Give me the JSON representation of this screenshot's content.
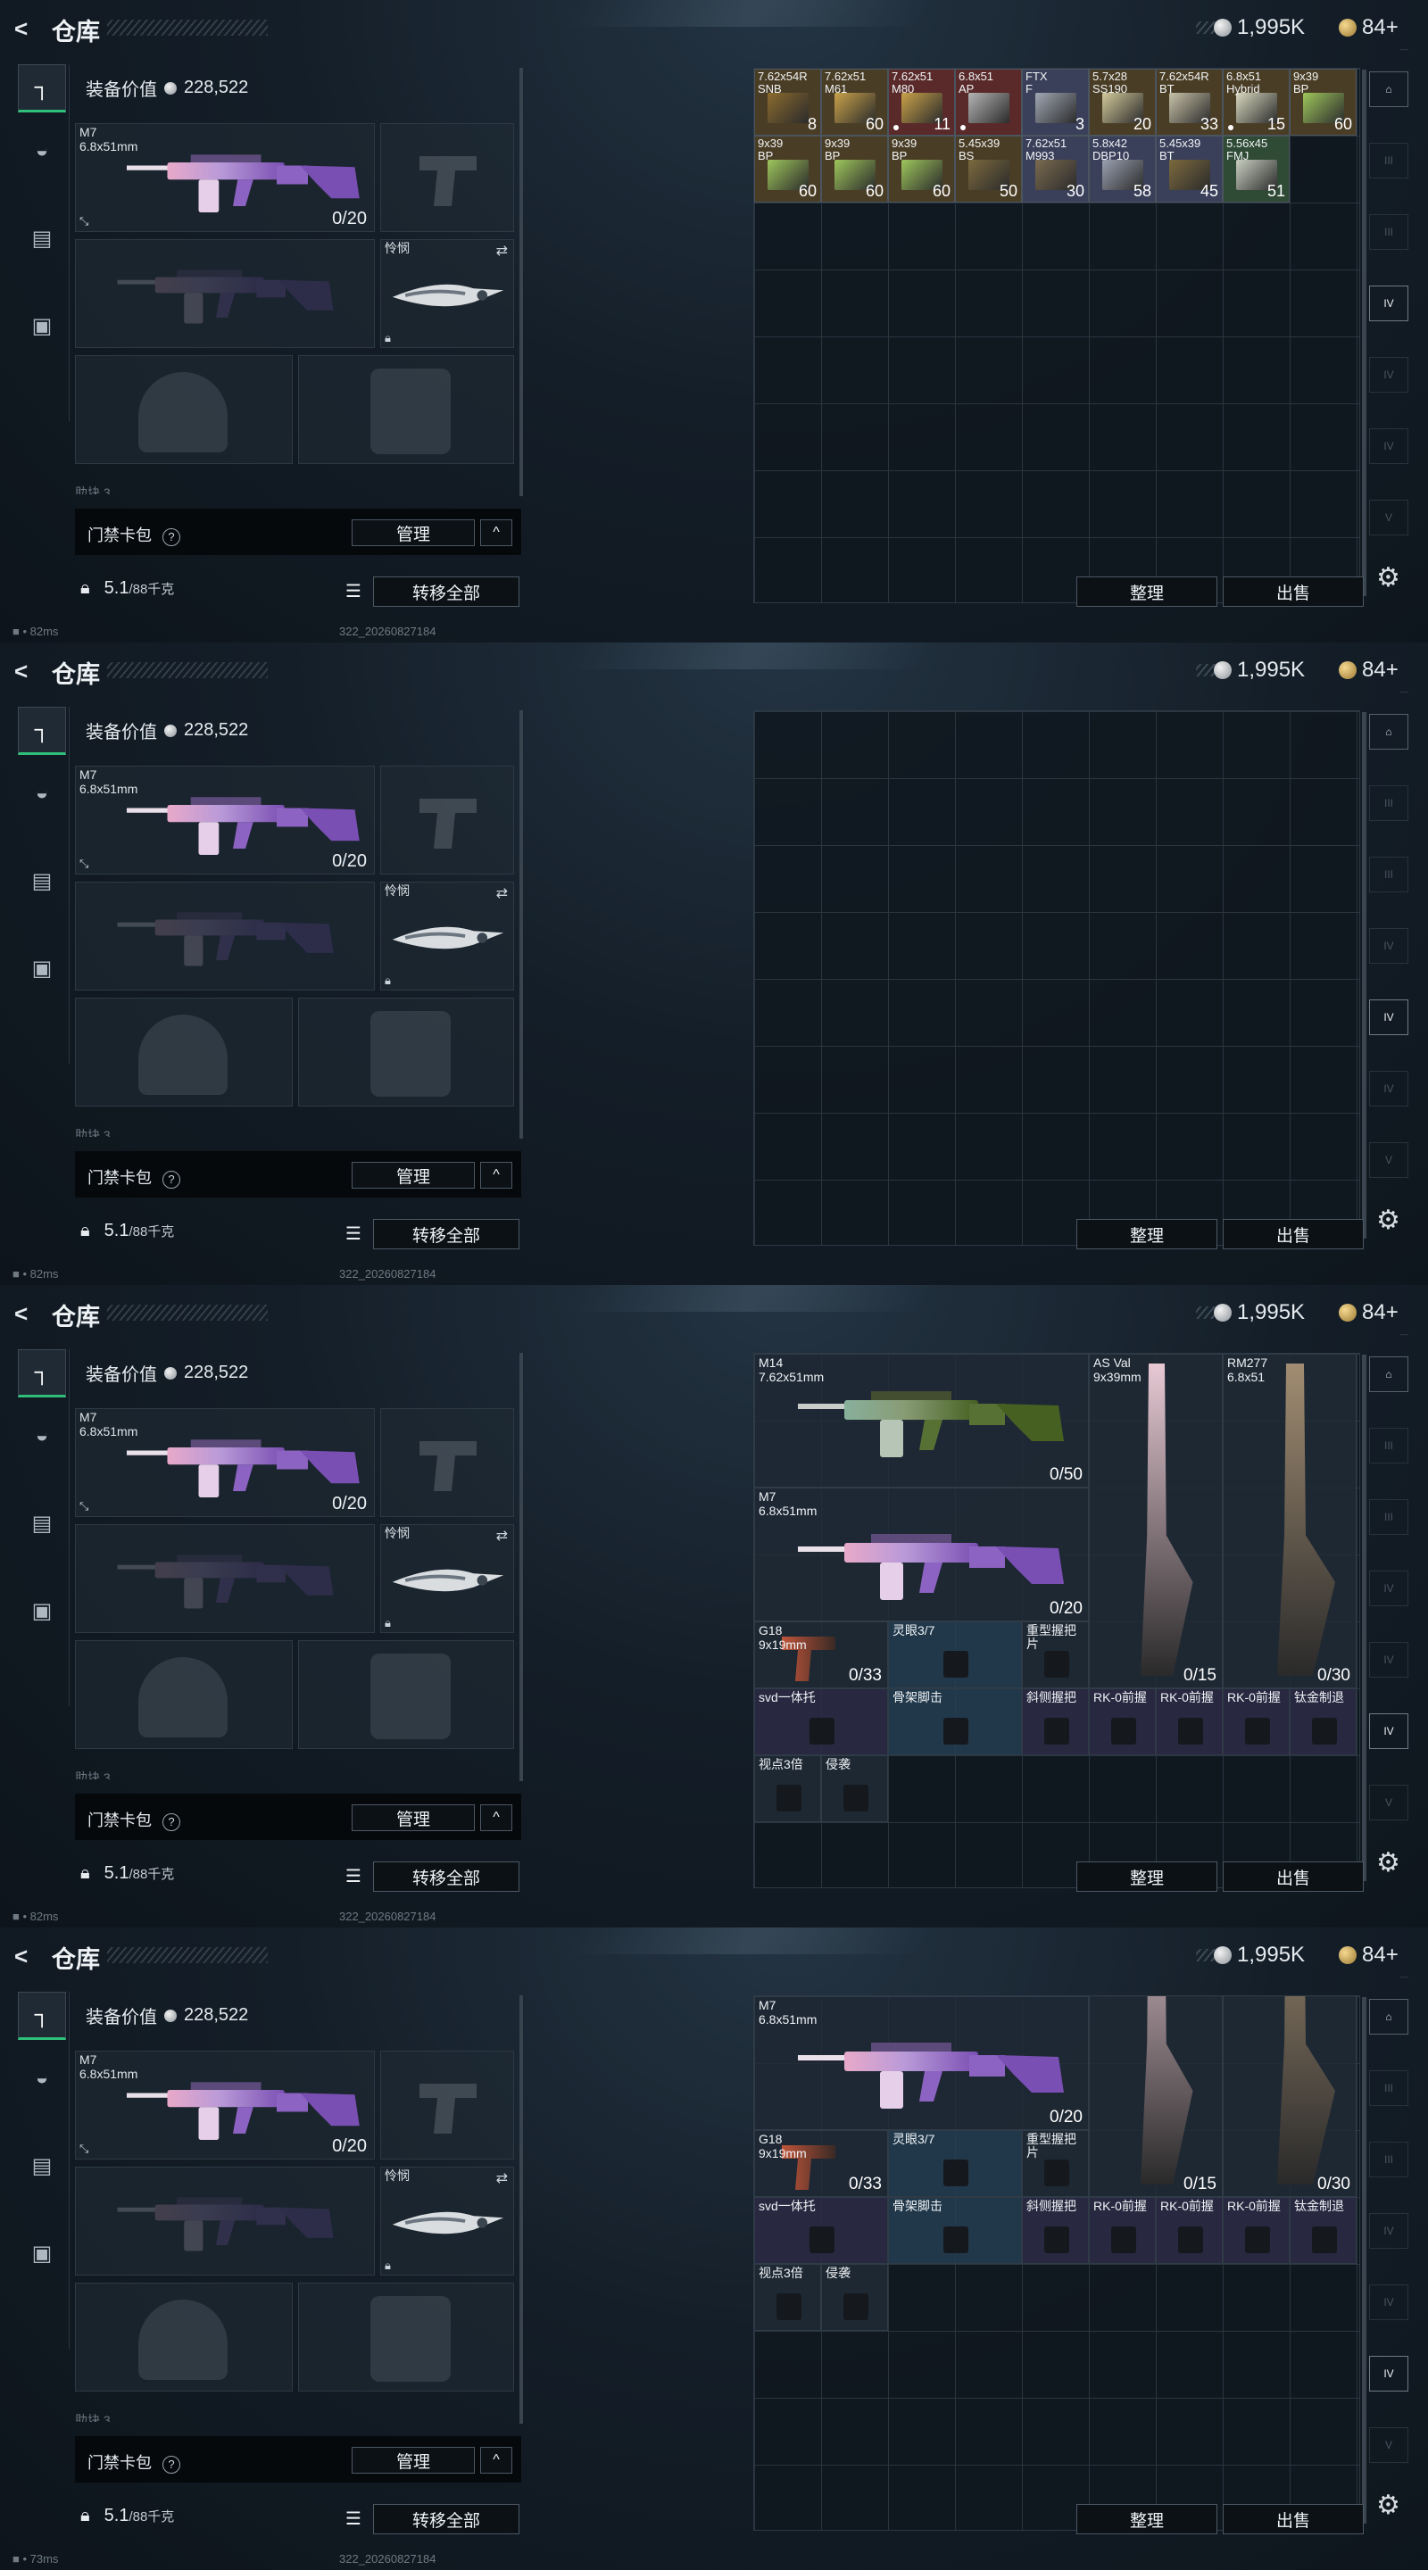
{
  "title": "仓库",
  "currency": {
    "silver": "1,995K",
    "gold": "84+"
  },
  "equipment": {
    "value_label": "装备价值",
    "value": "228,522",
    "primary": {
      "name": "M7",
      "caliber": "6.8x51mm",
      "ammo": "0/20"
    },
    "melee": {
      "name": "怜悯"
    },
    "cut_label": "助块 3"
  },
  "keycard": {
    "label": "门禁卡包",
    "help": "?",
    "manage": "管理",
    "collapse": "^"
  },
  "weight": {
    "current": "5.1",
    "max": "/88千克"
  },
  "buttons": {
    "transfer_all": "转移全部",
    "sort": "整理",
    "sell": "出售"
  },
  "status": {
    "ping": "82ms",
    "ping_last": "73ms",
    "build": "322_20260827184"
  },
  "side_tabs": [
    {
      "icon": "pistol-icon"
    },
    {
      "icon": "helmet-icon"
    },
    {
      "icon": "vest-icon"
    },
    {
      "icon": "backpack-icon"
    }
  ],
  "right_tabs": [
    {
      "icon": "arch-icon",
      "label": "⌂"
    },
    {
      "icon": "storage-tier-icon",
      "label": "III"
    },
    {
      "icon": "storage-tier-icon",
      "label": "III"
    },
    {
      "icon": "storage-tier-icon",
      "label": "IV"
    },
    {
      "icon": "storage-tier-icon",
      "label": "IV"
    },
    {
      "icon": "storage-tier-icon",
      "label": "IV"
    },
    {
      "icon": "storage-tier-icon",
      "label": "V"
    }
  ],
  "ammo_items": [
    {
      "n1": "7.62x54R",
      "n2": "SNB",
      "count": "8",
      "color": "#8b6b2e",
      "bg": "#4a3d25"
    },
    {
      "n1": "7.62x51",
      "n2": "M61",
      "count": "60",
      "color": "#c9a24a",
      "bg": "#4a3d25"
    },
    {
      "n1": "7.62x51",
      "n2": "M80",
      "count": "11",
      "color": "#c9a24a",
      "bg": "#5a2a2a",
      "dot": true
    },
    {
      "n1": "6.8x51",
      "n2": "AP",
      "count": "",
      "color": "#b4b4b4",
      "bg": "#5a2a2a",
      "dot": true
    },
    {
      "n1": "FTX",
      "n2": "F",
      "count": "3",
      "color": "#a0a8b4",
      "bg": "#3a3f5a"
    },
    {
      "n1": "5.7x28",
      "n2": "SS190",
      "count": "20",
      "color": "#d2c99a",
      "bg": "#4a3d25"
    },
    {
      "n1": "7.62x54R",
      "n2": "BT",
      "count": "33",
      "color": "#c8c2a8",
      "bg": "#4a3d25"
    },
    {
      "n1": "6.8x51",
      "n2": "Hybrid",
      "count": "15",
      "color": "#d8d8c0",
      "bg": "#4a3d25",
      "dot": true
    },
    {
      "n1": "9x39",
      "n2": "BP",
      "count": "60",
      "color": "#9ec65c",
      "bg": "#4a3d25"
    },
    {
      "n1": "9x39",
      "n2": "BP",
      "count": "60",
      "color": "#9ec65c",
      "bg": "#4a3d25"
    },
    {
      "n1": "9x39",
      "n2": "BP",
      "count": "60",
      "color": "#9ec65c",
      "bg": "#4a3d25"
    },
    {
      "n1": "9x39",
      "n2": "BP",
      "count": "60",
      "color": "#9ec65c",
      "bg": "#4a3d25"
    },
    {
      "n1": "5.45x39",
      "n2": "BS",
      "count": "50",
      "color": "#7c6a3e",
      "bg": "#4a3d25"
    },
    {
      "n1": "7.62x51",
      "n2": "M993",
      "count": "30",
      "color": "#7a6a50",
      "bg": "#3a3f5a"
    },
    {
      "n1": "5.8x42",
      "n2": "DBP10",
      "count": "58",
      "color": "#9aa0b0",
      "bg": "#3a3f5a"
    },
    {
      "n1": "5.45x39",
      "n2": "BT",
      "count": "45",
      "color": "#7c6a3e",
      "bg": "#3a3f5a"
    },
    {
      "n1": "5.56x45",
      "n2": "FMJ",
      "count": "51",
      "color": "#c9cfc0",
      "bg": "#2f4a35"
    }
  ],
  "weapons": {
    "m14": {
      "name": "M14",
      "caliber": "7.62x51mm",
      "ammo": "0/50"
    },
    "m7": {
      "name": "M7",
      "caliber": "6.8x51mm",
      "ammo": "0/20"
    },
    "asval": {
      "name": "AS Val",
      "caliber": "9x39mm",
      "ammo": "0/15"
    },
    "rm277": {
      "name": "RM277",
      "caliber": "6.8x51",
      "ammo": "0/30"
    },
    "g18": {
      "name": "G18",
      "caliber": "9x19mm",
      "ammo": "0/33"
    }
  },
  "attachments": [
    {
      "name": "灵眼3/7"
    },
    {
      "name": "重型握把片"
    },
    {
      "name": "svd一体托"
    },
    {
      "name": "骨架脚击"
    },
    {
      "name": "斜侧握把"
    },
    {
      "name": "RK-0前握"
    },
    {
      "name": "RK-0前握"
    },
    {
      "name": "RK-0前握"
    },
    {
      "name": "钛金制退"
    },
    {
      "name": "视点3倍"
    },
    {
      "name": "侵袭"
    }
  ]
}
